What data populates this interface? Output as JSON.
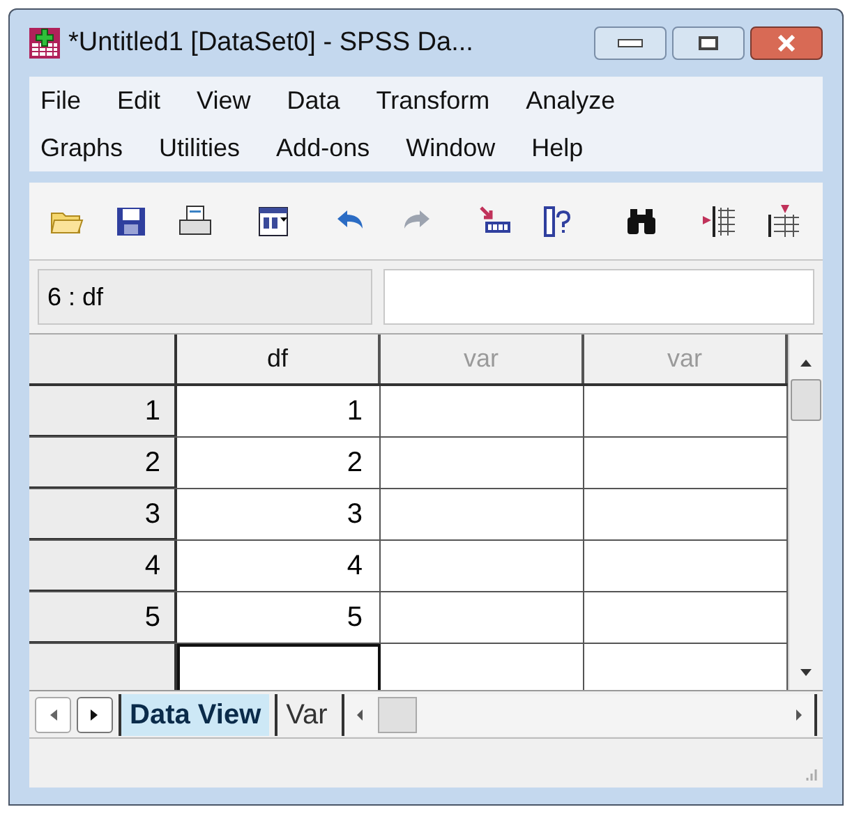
{
  "window": {
    "title": "*Untitled1 [DataSet0] - SPSS Da..."
  },
  "menu_rows": [
    [
      "File",
      "Edit",
      "View",
      "Data",
      "Transform",
      "Analyze"
    ],
    [
      "Graphs",
      "Utilities",
      "Add-ons",
      "Window",
      "Help"
    ]
  ],
  "toolbar": [
    {
      "kind": "open",
      "disabled": false
    },
    {
      "kind": "save",
      "disabled": false
    },
    {
      "kind": "print",
      "disabled": false
    },
    {
      "kind": "dialog",
      "disabled": false
    },
    {
      "kind": "undo",
      "disabled": false
    },
    {
      "kind": "redo",
      "disabled": true
    },
    {
      "kind": "goto",
      "disabled": false
    },
    {
      "kind": "varinfo",
      "disabled": false
    },
    {
      "kind": "find",
      "disabled": false
    },
    {
      "kind": "insertcase",
      "disabled": false
    },
    {
      "kind": "insertvar",
      "disabled": false
    }
  ],
  "cell_editor": {
    "reference": "6 : df"
  },
  "table": {
    "columns": [
      {
        "label": "df",
        "defined": true
      },
      {
        "label": "var",
        "defined": false
      },
      {
        "label": "var",
        "defined": false
      }
    ],
    "rows": [
      {
        "label": "1",
        "cells": [
          "1",
          "",
          ""
        ]
      },
      {
        "label": "2",
        "cells": [
          "2",
          "",
          ""
        ]
      },
      {
        "label": "3",
        "cells": [
          "3",
          "",
          ""
        ]
      },
      {
        "label": "4",
        "cells": [
          "4",
          "",
          ""
        ]
      },
      {
        "label": "5",
        "cells": [
          "5",
          "",
          ""
        ]
      }
    ]
  },
  "tabs": [
    {
      "label": "Data View",
      "selected": true
    },
    {
      "label": "Var",
      "selected": false
    }
  ]
}
